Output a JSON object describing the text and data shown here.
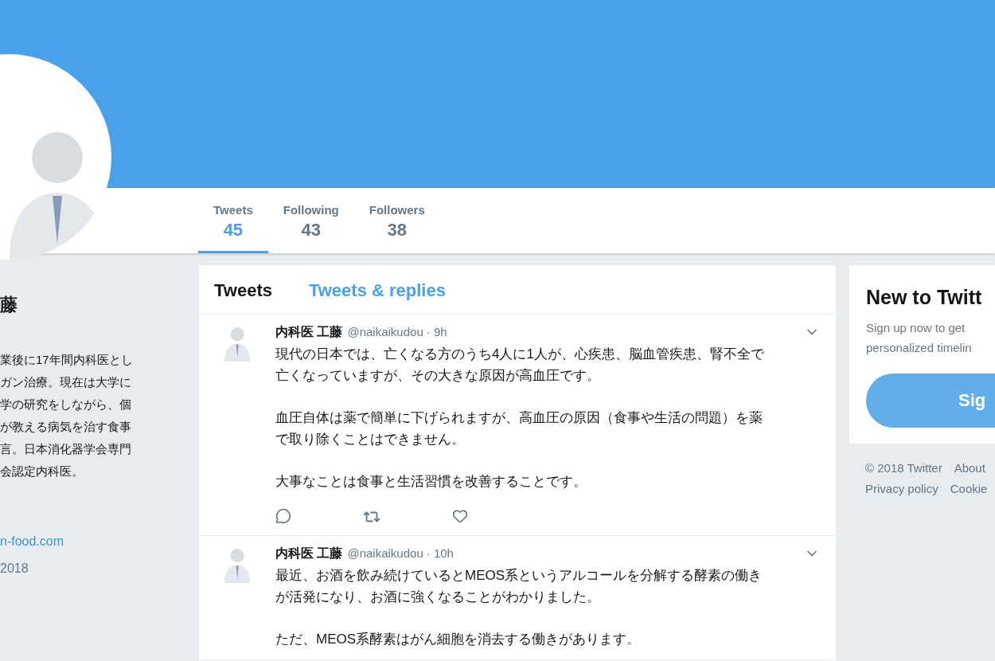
{
  "profile": {
    "name": "藤",
    "bio_lines": [
      "業後に17年間内科医とし",
      "ガン治療。現在は大学に",
      "学の研究をしながら、個",
      "が教える病気を治す食事",
      "言。日本消化器学会専門",
      "会認定内科医。"
    ],
    "link": "n-food.com",
    "joined": "2018"
  },
  "stats": [
    {
      "label": "Tweets",
      "value": "45",
      "selected": true
    },
    {
      "label": "Following",
      "value": "43",
      "selected": false
    },
    {
      "label": "Followers",
      "value": "38",
      "selected": false
    }
  ],
  "timeline_tabs": [
    {
      "label": "Tweets",
      "selected": true
    },
    {
      "label": "Tweets & replies",
      "selected": false
    }
  ],
  "tweets": [
    {
      "name": "内科医 工藤",
      "handle": "@naikaikudou",
      "time": "· 9h",
      "paragraphs": [
        [
          "現代の日本では、亡くなる方のうち4人に1人が、心疾患、脳血管疾患、腎不全で",
          "亡くなっていますが、その大きな原因が高血圧です。"
        ],
        [
          "血圧自体は薬で簡単に下げられますが、高血圧の原因（食事や生活の問題）を薬",
          "で取り除くことはできません。"
        ],
        [
          "大事なことは食事と生活習慣を改善することです。"
        ]
      ],
      "actions": true
    },
    {
      "name": "内科医 工藤",
      "handle": "@naikaikudou",
      "time": "· 10h",
      "paragraphs": [
        [
          "最近、お酒を飲み続けているとMEOS系というアルコールを分解する酵素の働き",
          "が活発になり、お酒に強くなることがわかりました。"
        ],
        [
          "ただ、MEOS系酵素はがん細胞を消去する働きがあります。"
        ]
      ],
      "actions": false
    }
  ],
  "signup": {
    "title": "New to Twitt",
    "text_lines": [
      "Sign up now to get",
      "personalized timelin"
    ],
    "button": "Sig"
  },
  "footer": [
    [
      "© 2018 Twitter",
      "About"
    ],
    [
      "Privacy policy",
      "Cookie"
    ]
  ]
}
